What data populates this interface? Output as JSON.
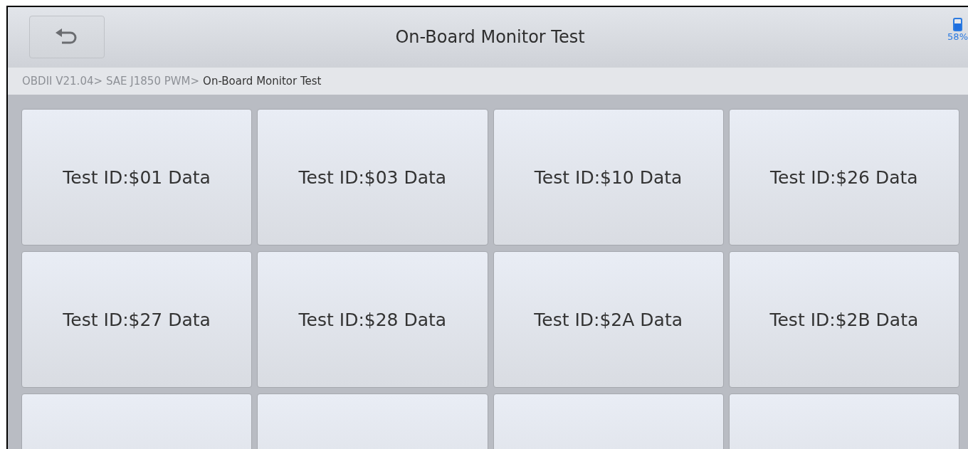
{
  "header": {
    "title": "On-Board Monitor Test",
    "battery": {
      "level": 0.58,
      "reading": "58%"
    }
  },
  "breadcrumb": [
    {
      "label": "OBDII V21.04>",
      "current": false
    },
    {
      "label": "SAE J1850 PWM>",
      "current": false
    },
    {
      "label": "On-Board Monitor Test",
      "current": true
    }
  ],
  "tiles": [
    {
      "kind": "test",
      "label": "Test ID:$01 Data"
    },
    {
      "kind": "test",
      "label": "Test ID:$03 Data"
    },
    {
      "kind": "test",
      "label": "Test ID:$10 Data"
    },
    {
      "kind": "test",
      "label": "Test ID:$26 Data"
    },
    {
      "kind": "test",
      "label": "Test ID:$27 Data"
    },
    {
      "kind": "test",
      "label": "Test ID:$28 Data"
    },
    {
      "kind": "test",
      "label": "Test ID:$2A Data"
    },
    {
      "kind": "test",
      "label": "Test ID:$2B Data"
    },
    {
      "kind": "blank"
    },
    {
      "kind": "blank"
    },
    {
      "kind": "blank"
    },
    {
      "kind": "blank"
    }
  ]
}
